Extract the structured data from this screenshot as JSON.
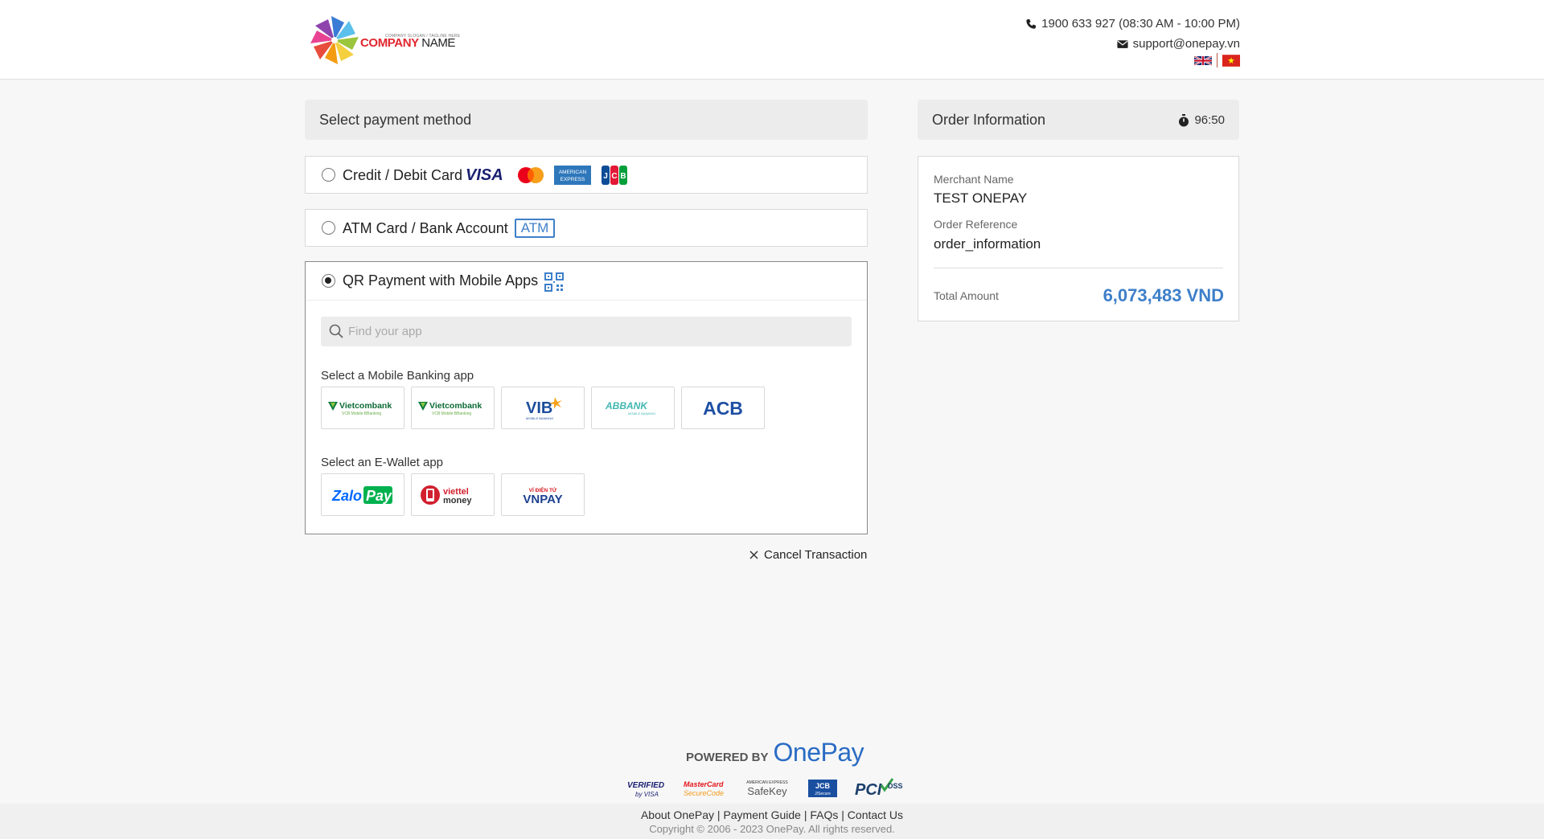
{
  "header": {
    "logo_slogan": "COMPANY SLOGAN / TAGLINE HERE",
    "logo_name_1": "COMPANY",
    "logo_name_2": "NAME",
    "phone": "1900 633 927 (08:30 AM - 10:00 PM)",
    "email": "support@onepay.vn",
    "languages": [
      "English",
      "Vietnamese"
    ]
  },
  "payment": {
    "title": "Select payment method",
    "methods": [
      {
        "label": "Credit / Debit Card",
        "selected": false,
        "icons": [
          "visa-logo",
          "mastercard-logo",
          "amex-logo",
          "jcb-logo"
        ]
      },
      {
        "label": "ATM Card / Bank Account",
        "selected": false,
        "badge": "ATM"
      },
      {
        "label": "QR Payment with Mobile Apps",
        "selected": true,
        "icons": [
          "qr-code-icon"
        ]
      }
    ],
    "search_placeholder": "Find your app",
    "banking_title": "Select a Mobile Banking app",
    "banking_apps": [
      "Vietcombank",
      "Vietcombank",
      "VIB",
      "ABBANK",
      "ACB"
    ],
    "banking_subtitles": [
      "VCB Mobile BBanking",
      "VCB Mobile BBanking",
      "MOBILE BANKING",
      "MOBILE BANKING",
      ""
    ],
    "wallet_title": "Select an E-Wallet app",
    "wallet_apps": [
      "ZaloPay",
      "viettel money",
      "VNPAY"
    ],
    "wallet_subtitles": [
      "",
      "",
      "VÍ ĐIỆN TỬ"
    ],
    "cancel_label": "Cancel Transaction"
  },
  "order": {
    "title": "Order Information",
    "timer": "96:50",
    "merchant_label": "Merchant Name",
    "merchant_value": "TEST ONEPAY",
    "reference_label": "Order Reference",
    "reference_value": "order_information",
    "total_label": "Total Amount",
    "total_value": "6,073,483 VND"
  },
  "footer": {
    "powered_by": "POWERED BY",
    "brand": "OnePay",
    "seals": [
      "Verified by VISA",
      "MasterCard SecureCode",
      "American Express SafeKey",
      "JCB J/Secure",
      "PCI DSS"
    ],
    "links": [
      "About OnePay",
      "Payment Guide",
      "FAQs",
      "Contact Us"
    ],
    "copyright": "Copyright © 2006 - 2023 OnePay. All rights reserved."
  },
  "colors": {
    "accent": "#3e7fc9",
    "brand_red": "#e0262f",
    "background": "#f7f7f7"
  }
}
